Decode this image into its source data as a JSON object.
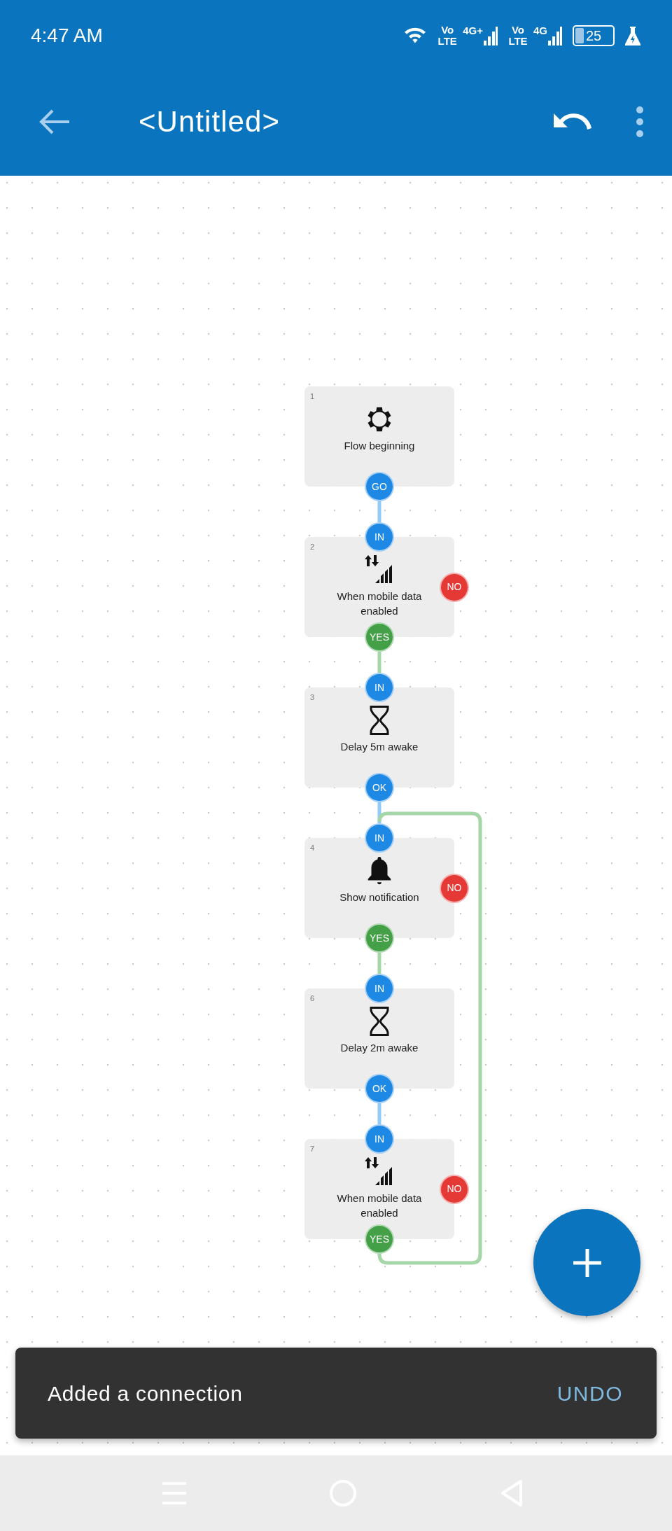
{
  "status_bar": {
    "time": "4:47 AM",
    "sims": [
      {
        "volte": "Vo LTE",
        "network": "4G+"
      },
      {
        "volte": "Vo LTE",
        "network": "4G"
      }
    ],
    "battery": "25"
  },
  "app_bar": {
    "title": "<Untitled>"
  },
  "nodes": [
    {
      "number": "1",
      "label": "Flow beginning",
      "kind": "gear",
      "ports": [
        {
          "label": "GO",
          "kind": "out"
        }
      ]
    },
    {
      "number": "2",
      "label": "When mobile data enabled",
      "kind": "mobile-data",
      "ports": [
        {
          "label": "IN",
          "kind": "in"
        },
        {
          "label": "NO",
          "kind": "no"
        },
        {
          "label": "YES",
          "kind": "yes"
        }
      ]
    },
    {
      "number": "3",
      "label": "Delay 5m awake",
      "kind": "delay",
      "ports": [
        {
          "label": "IN",
          "kind": "in"
        },
        {
          "label": "OK",
          "kind": "out"
        }
      ]
    },
    {
      "number": "4",
      "label": "Show notification",
      "kind": "notification",
      "loop_in": true,
      "ports": [
        {
          "label": "IN",
          "kind": "in"
        },
        {
          "label": "NO",
          "kind": "no"
        },
        {
          "label": "YES",
          "kind": "yes"
        }
      ]
    },
    {
      "number": "6",
      "label": "Delay 2m awake",
      "kind": "delay",
      "ports": [
        {
          "label": "IN",
          "kind": "in"
        },
        {
          "label": "OK",
          "kind": "out"
        }
      ]
    },
    {
      "number": "7",
      "label": "When mobile data enabled",
      "kind": "mobile-data",
      "loop_out": true,
      "ports": [
        {
          "label": "IN",
          "kind": "in"
        },
        {
          "label": "NO",
          "kind": "no"
        },
        {
          "label": "YES",
          "kind": "yes"
        }
      ]
    }
  ],
  "snackbar": {
    "message": "Added a connection",
    "action": "UNDO"
  }
}
